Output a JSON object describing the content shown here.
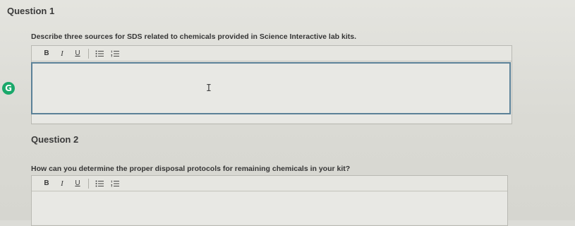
{
  "questions": [
    {
      "title": "Question 1",
      "prompt": "Describe three sources for SDS related to chemicals provided in Science Interactive lab kits.",
      "toolbar": {
        "bold": "B",
        "italic": "I",
        "underline": "U"
      }
    },
    {
      "title": "Question 2",
      "prompt": "How can you determine the proper disposal protocols for remaining chemicals in your kit?",
      "toolbar": {
        "bold": "B",
        "italic": "I",
        "underline": "U"
      }
    }
  ],
  "overlay": {
    "grammar_badge_letter": "G"
  },
  "icons": [
    "bulleted-list-icon",
    "numbered-list-icon",
    "grammar-assistant-icon",
    "text-cursor-icon"
  ],
  "colors": {
    "focus_border": "#5b8198",
    "grammar_badge": "#19a86a"
  }
}
